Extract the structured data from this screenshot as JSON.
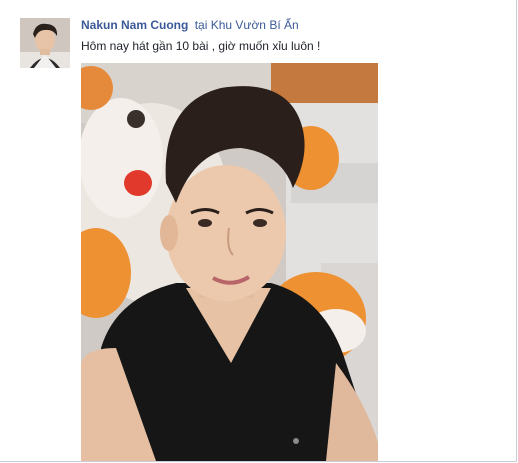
{
  "post": {
    "author": "Nakun Nam Cuong",
    "at_word": "tại",
    "place": "Khu Vườn Bí Ẩn",
    "message": "Hôm nay hát gần 10 bài , giờ muốn xỉu luôn !"
  },
  "colors": {
    "link": "#3b5998",
    "text": "#1d2129",
    "border": "#c8ccd6"
  }
}
